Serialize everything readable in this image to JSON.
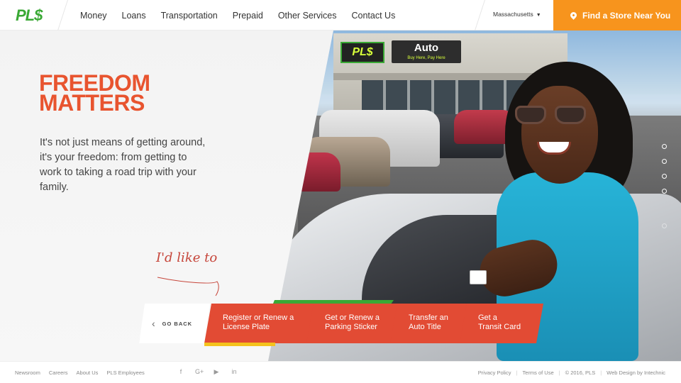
{
  "header": {
    "logo": "PL$",
    "nav": [
      "Money",
      "Loans",
      "Transportation",
      "Prepaid",
      "Other Services",
      "Contact Us"
    ],
    "state": "Massachusetts",
    "find_store": "Find a Store Near You"
  },
  "hero": {
    "title_line1": "FREEDOM",
    "title_line2": "MATTERS",
    "lede": "It's not just means of getting around, it's your freedom: from getting to work to taking a road trip with your family.",
    "handwritten": "I'd like to",
    "store_sign": "PL$",
    "auto_sign": "Auto",
    "auto_sign_sub": "Buy Here, Pay Here"
  },
  "actions": {
    "go_back": "GO BACK",
    "items": [
      {
        "line1": "Register or Renew a",
        "line2": "License Plate"
      },
      {
        "line1": "Get or Renew a",
        "line2": "Parking Sticker"
      },
      {
        "line1": "Transfer an",
        "line2": "Auto Title"
      },
      {
        "line1": "Get a",
        "line2": "Transit Card"
      }
    ]
  },
  "slider": {
    "dots": 6,
    "active_index": 0
  },
  "footer": {
    "links": [
      "Newsroom",
      "Careers",
      "About Us",
      "PLS Employees"
    ],
    "social": [
      "facebook-icon",
      "google-plus-icon",
      "youtube-icon",
      "linkedin-icon"
    ],
    "social_glyphs": [
      "f",
      "G+",
      "▶",
      "in"
    ],
    "privacy": "Privacy Policy",
    "terms": "Terms of Use",
    "copyright": "© 2016, PLS",
    "credit": "Web Design by Intechnic"
  },
  "colors": {
    "brand_green": "#3aa935",
    "brand_orange": "#f7941d",
    "action_red": "#e24b34",
    "title_red": "#e8542f"
  }
}
